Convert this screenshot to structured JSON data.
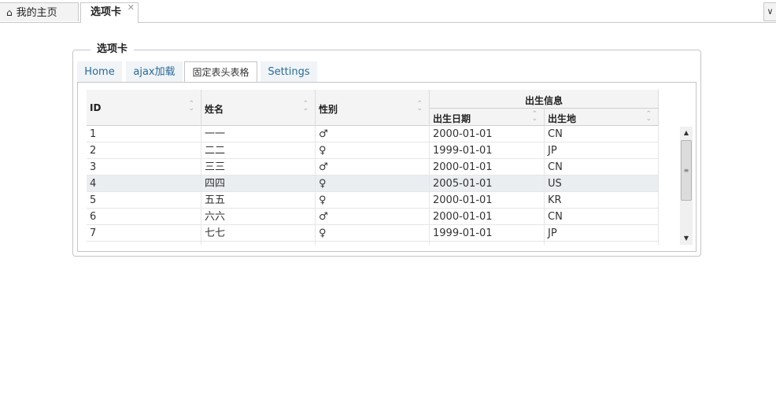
{
  "top_tabs": [
    {
      "label": "我的主页",
      "icon": "home-icon"
    },
    {
      "label": "选项卡",
      "icon": "close-icon"
    }
  ],
  "top_right_icon": "double-chevron-down-icon",
  "panel": {
    "legend": "选项卡",
    "tabs": [
      {
        "label": "Home"
      },
      {
        "label": "ajax加载"
      },
      {
        "label": "固定表头表格"
      },
      {
        "label": "Settings"
      }
    ],
    "active_tab": "固定表头表格"
  },
  "table": {
    "headers": {
      "id": "ID",
      "name": "姓名",
      "gender": "性别",
      "group": "出生信息",
      "birth_date": "出生日期",
      "birth_place": "出生地"
    },
    "rows": [
      {
        "id": "1",
        "name": "一一",
        "gender": "♂",
        "birth_date": "2000-01-01",
        "birth_place": "CN"
      },
      {
        "id": "2",
        "name": "二二",
        "gender": "♀",
        "birth_date": "1999-01-01",
        "birth_place": "JP"
      },
      {
        "id": "3",
        "name": "三三",
        "gender": "♂",
        "birth_date": "2000-01-01",
        "birth_place": "CN"
      },
      {
        "id": "4",
        "name": "四四",
        "gender": "♀",
        "birth_date": "2005-01-01",
        "birth_place": "US"
      },
      {
        "id": "5",
        "name": "五五",
        "gender": "♀",
        "birth_date": "2000-01-01",
        "birth_place": "KR"
      },
      {
        "id": "6",
        "name": "六六",
        "gender": "♂",
        "birth_date": "2000-01-01",
        "birth_place": "CN"
      },
      {
        "id": "7",
        "name": "七七",
        "gender": "♀",
        "birth_date": "1999-01-01",
        "birth_place": "JP"
      }
    ]
  },
  "colors": {
    "tab_link": "#2a6b9a",
    "header_bg": "#f4f4f4",
    "highlight_row": "#ebeef1",
    "border": "#c5c5c5"
  }
}
